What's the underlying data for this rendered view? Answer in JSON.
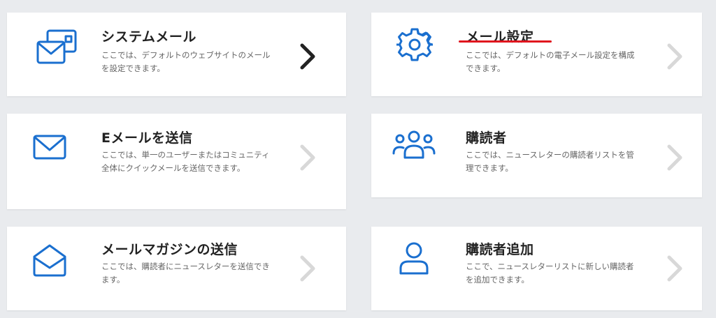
{
  "colors": {
    "background": "#e9ebee",
    "icon_blue": "#1a6fcf",
    "chevron_active": "#222222",
    "chevron_inactive": "#d8d8d8",
    "highlight_underline": "#e0141e"
  },
  "cards": [
    {
      "title": "システムメール",
      "description": "ここでは、デフォルトのウェブサイトのメールを設定できます。",
      "icon": "system-mail-icon",
      "chevron_active": true
    },
    {
      "title": "メール設定",
      "description": "ここでは、デフォルトの電子メール設定を構成できます。",
      "icon": "gear-icon",
      "chevron_active": false,
      "highlighted": true
    },
    {
      "title": "Eメールを送信",
      "description": "ここでは、単一のユーザーまたはコミュニティ全体にクイックメールを送信できます。",
      "icon": "envelope-icon",
      "chevron_active": false
    },
    {
      "title": "購読者",
      "description": "ここでは、ニュースレターの購読者リストを管理できます。",
      "icon": "users-group-icon",
      "chevron_active": false
    },
    {
      "title": "メールマガジンの送信",
      "description": "ここでは、購読者にニュースレターを送信できます。",
      "icon": "open-envelope-icon",
      "chevron_active": false
    },
    {
      "title": "購読者追加",
      "description": "ここで、ニュースレターリストに新しい購読者を追加できます。",
      "icon": "user-icon",
      "chevron_active": false
    }
  ]
}
